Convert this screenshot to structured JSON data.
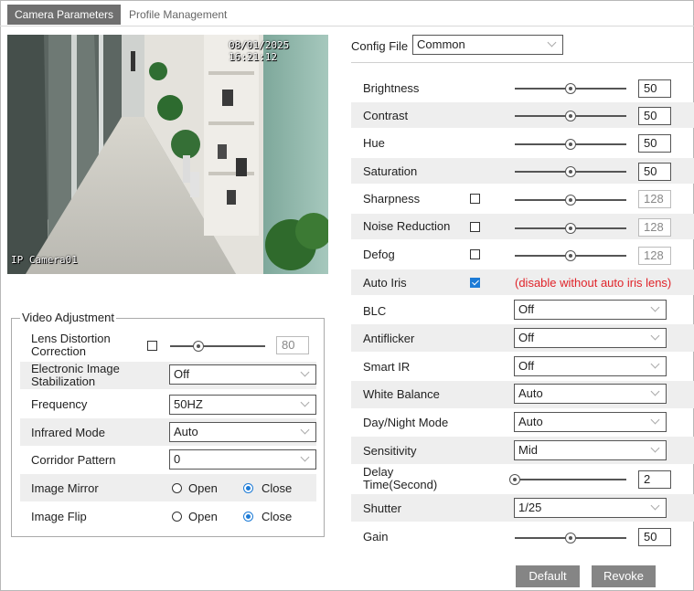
{
  "tabs": [
    "Camera Parameters",
    "Profile Management"
  ],
  "video": {
    "timestamp": "08/01/2025 16:21:12",
    "camera_name": "IP Camera01"
  },
  "config_file": {
    "label": "Config File",
    "value": "Common"
  },
  "image": {
    "brightness": {
      "label": "Brightness",
      "value": "50",
      "level": 0.5
    },
    "contrast": {
      "label": "Contrast",
      "value": "50",
      "level": 0.5
    },
    "hue": {
      "label": "Hue",
      "value": "50",
      "level": 0.5
    },
    "saturation": {
      "label": "Saturation",
      "value": "50",
      "level": 0.5
    },
    "sharpness": {
      "label": "Sharpness",
      "value": "128",
      "level": 0.5,
      "enabled": false
    },
    "noise_reduction": {
      "label": "Noise Reduction",
      "value": "128",
      "level": 0.5,
      "enabled": false
    },
    "defog": {
      "label": "Defog",
      "value": "128",
      "level": 0.5,
      "enabled": false
    },
    "auto_iris": {
      "label": "Auto Iris",
      "enabled": true,
      "note": "(disable without auto iris lens)"
    },
    "blc": {
      "label": "BLC",
      "value": "Off"
    },
    "antiflicker": {
      "label": "Antiflicker",
      "value": "Off"
    },
    "smart_ir": {
      "label": "Smart IR",
      "value": "Off"
    },
    "white_balance": {
      "label": "White Balance",
      "value": "Auto"
    },
    "day_night_mode": {
      "label": "Day/Night Mode",
      "value": "Auto"
    },
    "sensitivity": {
      "label": "Sensitivity",
      "value": "Mid"
    },
    "delay_time": {
      "label_line1": "Delay",
      "label_line2": "Time(Second)",
      "value": "2",
      "level": 0.0
    },
    "shutter": {
      "label": "Shutter",
      "value": "1/25"
    },
    "gain": {
      "label": "Gain",
      "value": "50",
      "level": 0.5
    }
  },
  "video_adjustment": {
    "title": "Video Adjustment",
    "lens_distortion": {
      "label_line1": "Lens Distortion",
      "label_line2": "Correction",
      "value": "80",
      "level": 0.3,
      "enabled": false
    },
    "eis": {
      "label_line1": "Electronic Image",
      "label_line2": "Stabilization",
      "value": "Off"
    },
    "frequency": {
      "label": "Frequency",
      "value": "50HZ"
    },
    "infrared_mode": {
      "label": "Infrared Mode",
      "value": "Auto"
    },
    "corridor_pattern": {
      "label": "Corridor Pattern",
      "value": "0"
    },
    "image_mirror": {
      "label": "Image Mirror",
      "open": "Open",
      "close": "Close",
      "selected": "Close"
    },
    "image_flip": {
      "label": "Image Flip",
      "open": "Open",
      "close": "Close",
      "selected": "Close"
    }
  },
  "buttons": {
    "default": "Default",
    "revoke": "Revoke"
  },
  "colors": {
    "active_tab": "#6f6f6f",
    "accent": "#1d7bd6",
    "warning": "#e0242a",
    "row_bg": "#eeeeee",
    "button": "#858585"
  }
}
